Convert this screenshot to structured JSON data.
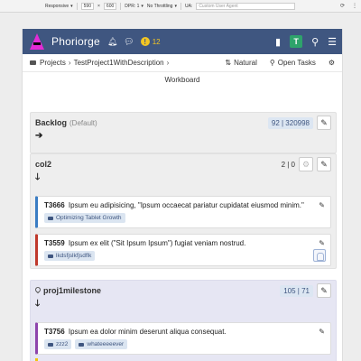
{
  "devtools": {
    "device": "Responsive",
    "width": "590",
    "height": "600",
    "dpr": "DPR: 1",
    "throttle": "No Throttling",
    "ua_label": "UA:",
    "ua_placeholder": "Custom User Agent"
  },
  "nav": {
    "brand": "Phoriorge",
    "warning_count": "12",
    "avatar_letter": "T",
    "colors": {
      "bar": "#3f5680",
      "logo": "#e32bd5",
      "warning": "#f3c623",
      "avatar": "#2ea36b"
    }
  },
  "breadcrumb": {
    "projects": "Projects",
    "project": "TestProject1WithDescription",
    "sort": "Natural",
    "open_tasks": "Open Tasks"
  },
  "page": {
    "title": "Workboard"
  },
  "columns": [
    {
      "title": "Backlog",
      "subtitle": "(Default)",
      "count": "92 | 320998",
      "arrow": "➔"
    },
    {
      "title": "col2",
      "count": "2 | 0",
      "arrow": "➔"
    },
    {
      "title": "proj1milestone",
      "count": "105 | 71",
      "arrow": "➔"
    }
  ],
  "cards": [
    {
      "id": "T3666",
      "text": "Ipsum eu adipisicing, \"Ipsum occaecat pariatur cupidatat eiusmod minim.\"",
      "tags": [
        "Optimizing Tablet Growth"
      ]
    },
    {
      "id": "T3559",
      "text": "Ipsum ex elit (\"Sit Ipsum Ipsum\") fugiat veniam nostrud.",
      "tags": [
        "lkdsfjslkfjsdflk"
      ]
    },
    {
      "id": "T3756",
      "text": "Ipsum ea dolor minim deserunt aliqua consequat.",
      "tags": [
        "zzz2",
        "whateeeeever"
      ]
    }
  ]
}
